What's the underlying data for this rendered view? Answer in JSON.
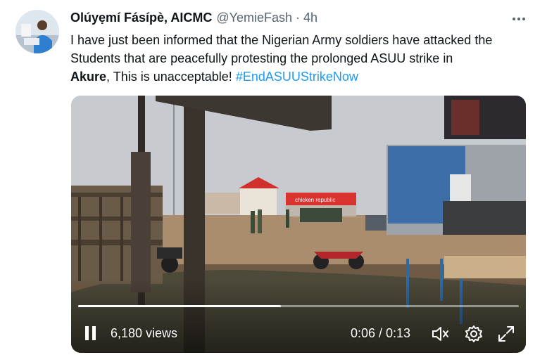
{
  "tweet": {
    "author_name": "Olúyẹmí Fásípè, AICMC",
    "handle": "@YemieFash",
    "separator": "·",
    "time": "4h",
    "text_line1": "I have just been informed that the Nigerian Army soldiers have attacked the",
    "text_line2": "Students that are peacefully protesting the prolonged ASUU strike in",
    "text_bold": "Akure",
    "text_rest": ", This is unacceptable! ",
    "hashtag": "#EndASUUStrikeNow"
  },
  "video": {
    "views": "6,180 views",
    "timecode": "0:06 / 0:13",
    "progress": 0.46,
    "shop_sign": "chicken republic"
  },
  "icons": {
    "more": "more-icon",
    "pause": "pause-icon",
    "mute": "mute-icon",
    "settings": "settings-icon",
    "fullscreen": "fullscreen-icon"
  },
  "colors": {
    "accent": "#1d9bf0",
    "text": "#0f1419",
    "secondary": "#536471"
  }
}
